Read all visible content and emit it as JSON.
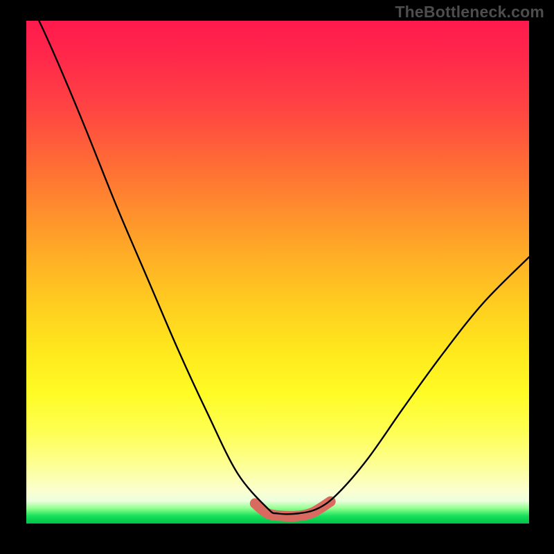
{
  "watermark": "TheBottleneck.com",
  "chart_data": {
    "type": "line",
    "title": "",
    "xlabel": "",
    "ylabel": "",
    "xlim": [
      0,
      1
    ],
    "ylim": [
      0,
      1
    ],
    "series": [
      {
        "name": "bottleneck-curve",
        "x": [
          0.0,
          0.03,
          0.07,
          0.12,
          0.18,
          0.24,
          0.3,
          0.36,
          0.42,
          0.48,
          0.5,
          0.54,
          0.58,
          0.62,
          0.68,
          0.75,
          0.83,
          0.91,
          1.0
        ],
        "y": [
          1.05,
          0.99,
          0.9,
          0.78,
          0.63,
          0.49,
          0.35,
          0.22,
          0.1,
          0.03,
          0.02,
          0.02,
          0.03,
          0.06,
          0.13,
          0.23,
          0.34,
          0.44,
          0.53
        ]
      },
      {
        "name": "optimal-band",
        "x": [
          0.455,
          0.48,
          0.51,
          0.54,
          0.57,
          0.605
        ],
        "y": [
          0.04,
          0.02,
          0.015,
          0.015,
          0.022,
          0.044
        ]
      }
    ],
    "colors": {
      "curve": "#000000",
      "band": "#d86a60",
      "top": "#ff1a4d",
      "mid": "#fff01e",
      "bottom": "#00c24a"
    },
    "legend": null,
    "grid": false
  }
}
